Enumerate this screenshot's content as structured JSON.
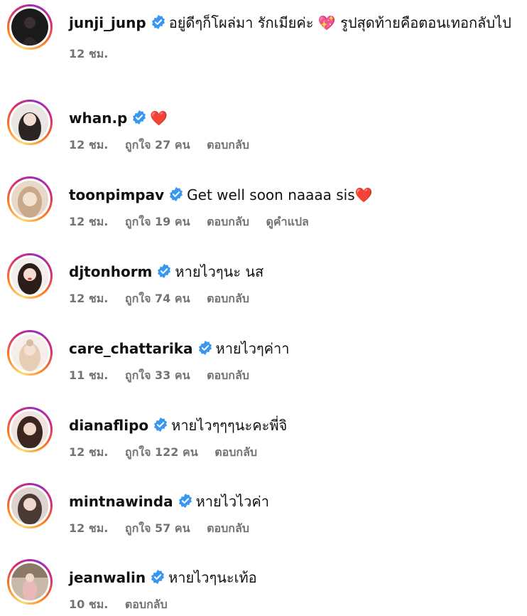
{
  "comments": [
    {
      "username": "junji_junp",
      "text": "อยู่ดีๆก็โผล่มา รักเมียค่ะ 💖 รูปสุดท้ายคือตอนเทอกลับไป",
      "time": "12 ชม.",
      "likes": "",
      "reply": "",
      "translate": ""
    },
    {
      "username": "whan.p",
      "text": "❤️",
      "time": "12 ชม.",
      "likes": "ถูกใจ 27 คน",
      "reply": "ตอบกลับ",
      "translate": ""
    },
    {
      "username": "toonpimpav",
      "text": "Get well soon naaaa sis❤️",
      "time": "12 ชม.",
      "likes": "ถูกใจ 19 คน",
      "reply": "ตอบกลับ",
      "translate": "ดูคำแปล"
    },
    {
      "username": "djtonhorm",
      "text": "หายไวๆนะ นส",
      "time": "12 ชม.",
      "likes": "ถูกใจ 74 คน",
      "reply": "ตอบกลับ",
      "translate": ""
    },
    {
      "username": "care_chattarika",
      "text": "หายไวๆค่าา",
      "time": "11 ชม.",
      "likes": "ถูกใจ 33 คน",
      "reply": "ตอบกลับ",
      "translate": ""
    },
    {
      "username": "dianaflipo",
      "text": "หายไวๆๆๆนะคะพี่จิ",
      "time": "12 ชม.",
      "likes": "ถูกใจ 122 คน",
      "reply": "ตอบกลับ",
      "translate": ""
    },
    {
      "username": "mintnawinda",
      "text": "หายไวไวค่า",
      "time": "12 ชม.",
      "likes": "ถูกใจ 57 คน",
      "reply": "ตอบกลับ",
      "translate": ""
    },
    {
      "username": "jeanwalin",
      "text": "หายไวๆนะเท้อ",
      "time": "10 ชม.",
      "likes": "",
      "reply": "ตอบกลับ",
      "translate": ""
    }
  ],
  "icons": {
    "verified": "verified-badge-icon",
    "avatar_ring_colors": [
      "#feda75",
      "#fa7e1e",
      "#d62976",
      "#962fbf"
    ],
    "verified_color": "#3897f0"
  }
}
